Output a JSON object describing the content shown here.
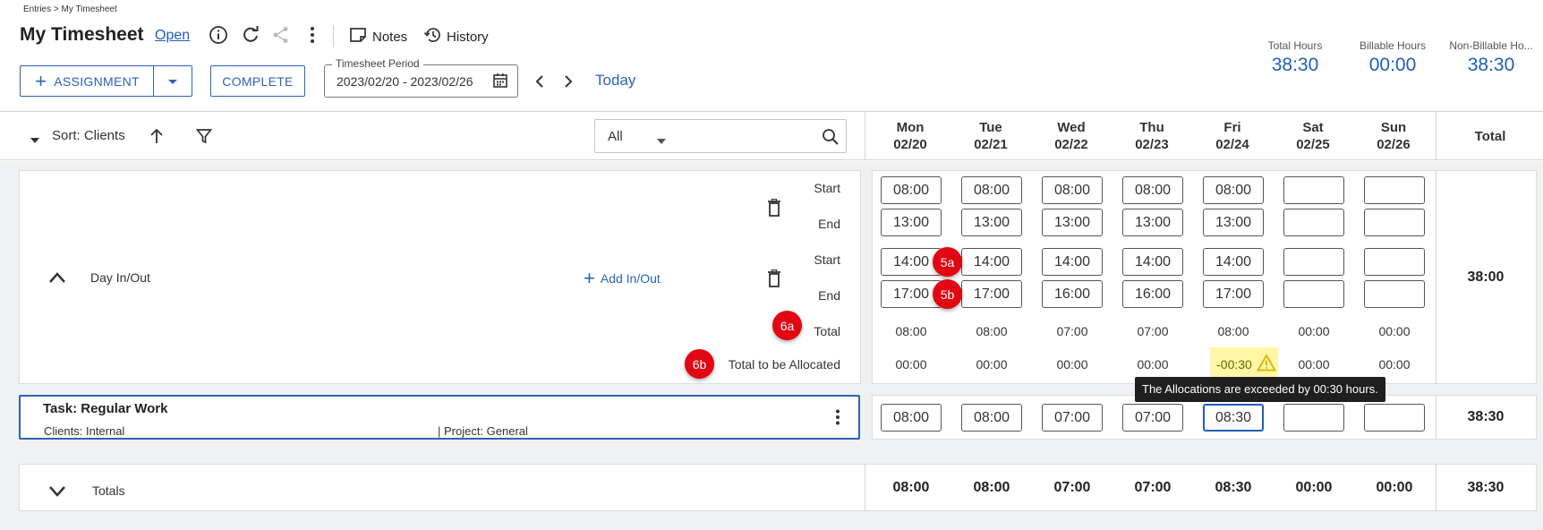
{
  "breadcrumb": "Entries > My Timesheet",
  "header": {
    "title": "My Timesheet",
    "status": "Open",
    "notes_label": "Notes",
    "history_label": "History"
  },
  "stats": [
    {
      "label": "Total Hours",
      "value": "38:30"
    },
    {
      "label": "Billable Hours",
      "value": "00:00"
    },
    {
      "label": "Non-Billable Ho...",
      "value": "38:30"
    }
  ],
  "toolbar": {
    "assignment_label": "ASSIGNMENT",
    "complete_label": "COMPLETE",
    "period_label": "Timesheet Period",
    "period_value": "2023/02/20 - 2023/02/26",
    "today_label": "Today",
    "sort_label": "Sort: Clients",
    "filter_value": "All"
  },
  "days": [
    {
      "name": "Mon",
      "date": "02/20"
    },
    {
      "name": "Tue",
      "date": "02/21"
    },
    {
      "name": "Wed",
      "date": "02/22"
    },
    {
      "name": "Thu",
      "date": "02/23"
    },
    {
      "name": "Fri",
      "date": "02/24"
    },
    {
      "name": "Sat",
      "date": "02/25"
    },
    {
      "name": "Sun",
      "date": "02/26"
    }
  ],
  "total_header": "Total",
  "day_inout": {
    "label": "Day In/Out",
    "add_label": "Add In/Out",
    "start_label": "Start",
    "end_label": "End",
    "total_label": "Total",
    "to_allocate_label": "Total to be Allocated",
    "start1": [
      "08:00",
      "08:00",
      "08:00",
      "08:00",
      "08:00",
      "",
      ""
    ],
    "end1": [
      "13:00",
      "13:00",
      "13:00",
      "13:00",
      "13:00",
      "",
      ""
    ],
    "start2": [
      "14:00",
      "14:00",
      "14:00",
      "14:00",
      "14:00",
      "",
      ""
    ],
    "end2": [
      "17:00",
      "17:00",
      "16:00",
      "16:00",
      "17:00",
      "",
      ""
    ],
    "totals": [
      "08:00",
      "08:00",
      "07:00",
      "07:00",
      "08:00",
      "00:00",
      "00:00"
    ],
    "to_allocate": [
      "00:00",
      "00:00",
      "00:00",
      "00:00",
      "-00:30",
      "00:00",
      "00:00"
    ],
    "row_total": "38:00"
  },
  "task": {
    "title": "Task: Regular Work",
    "client": "Clients: Internal",
    "project": "| Project: General",
    "values": [
      "08:00",
      "08:00",
      "07:00",
      "07:00",
      "08:30",
      "",
      ""
    ],
    "row_total": "38:30"
  },
  "totals_row": {
    "label": "Totals",
    "values": [
      "08:00",
      "08:00",
      "07:00",
      "07:00",
      "08:30",
      "00:00",
      "00:00"
    ],
    "total": "38:30"
  },
  "tooltip": "The Allocations are exceeded by 00:30 hours.",
  "badges": {
    "b5a": "5a",
    "b5b": "5b",
    "b6a": "6a",
    "b6b": "6b"
  },
  "colors": {
    "accent": "#1f5fb6",
    "badge": "#e20613",
    "warning_bg": "#fff6a6"
  }
}
